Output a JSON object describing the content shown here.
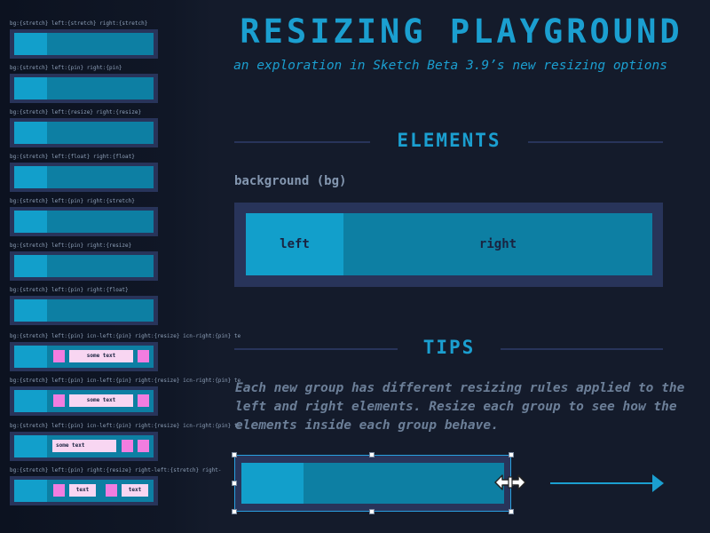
{
  "header": {
    "title": "RESIZING PLAYGROUND",
    "subtitle": "an exploration in Sketch Beta 3.9’s new resizing options"
  },
  "sections": {
    "elements": "ELEMENTS",
    "bg_label": "background (bg)",
    "demo_left": "left",
    "demo_right": "right",
    "tips": "TIPS",
    "tips_body": "Each new group has different resizing rules applied to the left and right elements. Resize each group to see how the elements inside each group behave."
  },
  "sidebar": {
    "rows": [
      {
        "label": "bg:{stretch}  left:{stretch}  right:{stretch}"
      },
      {
        "label": "bg:{stretch}  left:{pin}  right:{pin}"
      },
      {
        "label": "bg:{stretch}  left:{resize}  right:{resize}"
      },
      {
        "label": "bg:{stretch}  left:{float}  right:{float}"
      },
      {
        "label": "bg:{stretch}  left:{pin}  right:{stretch}"
      },
      {
        "label": "bg:{stretch}  left:{pin}  right:{resize}"
      },
      {
        "label": "bg:{stretch}  left:{pin}  right:{float}"
      },
      {
        "label": "bg:{stretch}  left:{pin}  icn-left:{pin}  right:{resize}  icn-right:{pin}  te",
        "text": "some text"
      },
      {
        "label": "bg:{stretch}  left:{pin}  icn-left:{pin}  right:{resize}  icn-right:{pin}  te",
        "text": "some text"
      },
      {
        "label": "bg:{stretch}  left:{pin}  icn-left:{pin}  right:{resize}  icn-right:{pin}  te",
        "text": "some text"
      },
      {
        "label": "bg:{stretch}  left:{pin}  right:{resize}  right-left:{stretch}  right-",
        "text1": "text",
        "text2": "text"
      }
    ]
  },
  "colors": {
    "accent": "#1b9fd0",
    "frame": "#28345a",
    "left_fill": "#129fcb",
    "right_fill": "#0d7fa3",
    "pink": "#f27de0",
    "pink_light": "#f8d6f2",
    "background": "#141b2b"
  },
  "icons": {
    "resize_cursor": "horizontal-resize-cursor-icon",
    "arrow": "arrow-right-icon"
  }
}
